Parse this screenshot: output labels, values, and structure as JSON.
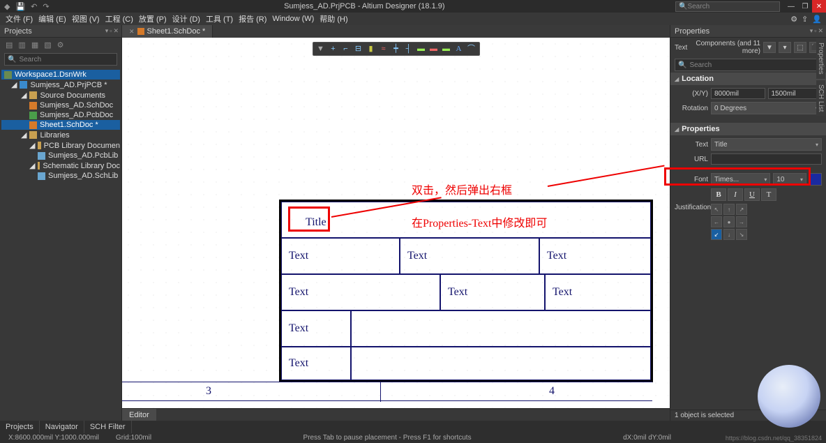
{
  "titlebar": {
    "title": "Sumjess_AD.PrjPCB - Altium Designer (18.1.9)",
    "search_placeholder": "Search"
  },
  "menu": [
    "文件 (F)",
    "编辑 (E)",
    "视图 (V)",
    "工程 (C)",
    "放置 (P)",
    "设计 (D)",
    "工具 (T)",
    "报告 (R)",
    "Window (W)",
    "帮助 (H)"
  ],
  "projects": {
    "title": "Projects",
    "search": "Search",
    "tree": {
      "workspace": "Workspace1.DsnWrk",
      "project": "Sumjess_AD.PrjPCB *",
      "src_label": "Source Documents",
      "docs": [
        "Sumjess_AD.SchDoc",
        "Sumjess_AD.PcbDoc",
        "Sheet1.SchDoc *"
      ],
      "lib_label": "Libraries",
      "pcb_lib_folder": "PCB Library Documen",
      "pcb_lib": "Sumjess_AD.PcbLib",
      "sch_lib_folder": "Schematic Library Doc",
      "sch_lib": "Sumjess_AD.SchLib"
    }
  },
  "doc_tab": "Sheet1.SchDoc *",
  "schematic": {
    "title": "Title",
    "texts": [
      "Text",
      "Text",
      "Text",
      "Text",
      "Text",
      "Text",
      "Text",
      "Text"
    ],
    "page_left": "3",
    "page_right": "4"
  },
  "annotations": {
    "a1": "双击，然后弹出右框",
    "a2": "在Properties-Text中修改即可"
  },
  "editor_tab": "Editor",
  "props": {
    "title": "Properties",
    "filter_label": "Text",
    "filter_text": "Components (and 11 more)",
    "search": "Search",
    "sections": {
      "location": "Location",
      "properties": "Properties"
    },
    "labels": {
      "xy": "(X/Y)",
      "rotation": "Rotation",
      "text": "Text",
      "url": "URL",
      "font": "Font",
      "justification": "Justification"
    },
    "values": {
      "x": "8000mil",
      "y": "1500mil",
      "rotation": "0 Degrees",
      "text": "Title",
      "url": "",
      "font_name": "Times...",
      "font_size": "10"
    },
    "style": {
      "bold": "B",
      "italic": "I",
      "underline": "U",
      "strike": "T"
    }
  },
  "side_tabs": [
    "Properties",
    "SCH List"
  ],
  "bottom_tabs": [
    "Projects",
    "Navigator",
    "SCH Filter"
  ],
  "status": {
    "xy": "X:8600.000mil Y:1000.000mil",
    "grid": "Grid:100mil",
    "hint": "Press Tab to pause placement - Press F1 for shortcuts",
    "dxy": "dX:0mil dY:0mil",
    "sel": "1 object is selected"
  },
  "watermark": "https://blog.csdn.net/qq_38351824"
}
